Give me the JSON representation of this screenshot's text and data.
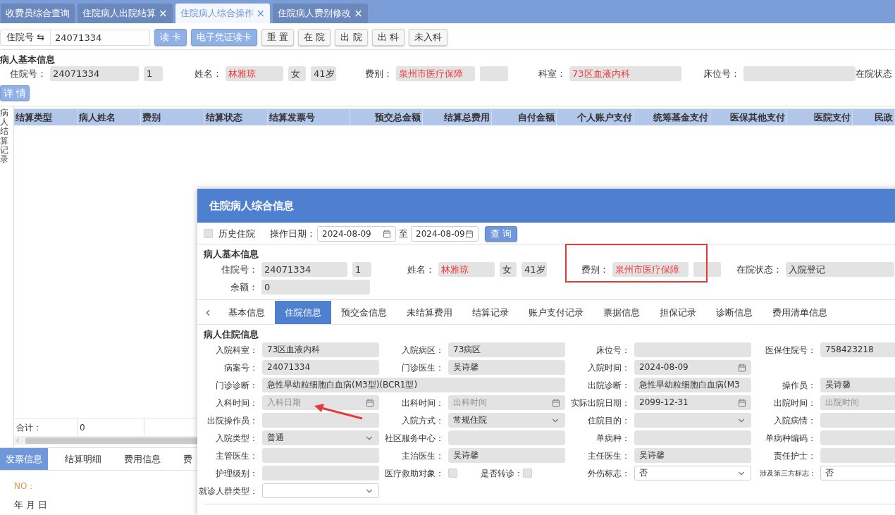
{
  "tabs": [
    {
      "label": "收费员综合查询",
      "selected": false
    },
    {
      "label": "住院病人出院结算",
      "close": "×",
      "selected": false
    },
    {
      "label": "住院病人综合操作",
      "close": "×",
      "selected": true
    },
    {
      "label": "住院病人费别修改",
      "close": "×",
      "selected": false
    }
  ],
  "toolbar": {
    "label": "住院号 ⇆",
    "value": "24071334",
    "buttons": [
      {
        "label": "读 卡",
        "primary": true
      },
      {
        "label": "电子凭证读卡",
        "primary": true
      },
      {
        "label": "重 置",
        "primary": false
      },
      {
        "label": "在 院",
        "primary": false
      },
      {
        "label": "出 院",
        "primary": false
      },
      {
        "label": "出 科",
        "primary": false
      },
      {
        "label": "未入科",
        "primary": false
      }
    ]
  },
  "patient_info": {
    "title": "病人基本信息",
    "groups": [
      {
        "label": "住院号：",
        "boxes": [
          {
            "kind": "text",
            "value": "24071334",
            "highlighted": false
          },
          {
            "kind": "text",
            "value": "1",
            "highlighted": false
          }
        ]
      },
      {
        "label": "姓名：",
        "boxes": [
          {
            "kind": "text",
            "value": "林雅琼",
            "highlighted": true
          },
          {
            "kind": "text",
            "value": "女",
            "highlighted": false
          },
          {
            "kind": "text",
            "value": "41岁",
            "highlighted": false
          }
        ]
      },
      {
        "label": "费别：",
        "boxes": [
          {
            "kind": "text",
            "value": "泉州市医疗保障",
            "highlighted": true
          },
          {
            "kind": "blank"
          }
        ]
      },
      {
        "label": "科室：",
        "boxes": [
          {
            "kind": "text",
            "value": "73区血液内科",
            "highlighted": true
          }
        ]
      },
      {
        "label": "床位号：",
        "boxes": [
          {
            "kind": "blank"
          }
        ]
      },
      {
        "label": "在院状态"
      }
    ]
  },
  "detail_button": "详 情",
  "records": {
    "side_label": "病人结算记录",
    "columns": [
      {
        "label": "结算类型",
        "kind": "text"
      },
      {
        "label": "病人姓名",
        "kind": "text"
      },
      {
        "label": "费别",
        "kind": "text"
      },
      {
        "label": "结算状态",
        "kind": "text"
      },
      {
        "label": "结算发票号",
        "kind": "text"
      },
      {
        "label": "预交总金额",
        "kind": "amount"
      },
      {
        "label": "结算总费用",
        "kind": "amount"
      },
      {
        "label": "自付金额",
        "kind": "amount"
      },
      {
        "label": "个人账户支付",
        "kind": "amount"
      },
      {
        "label": "统筹基金支付",
        "kind": "amount"
      },
      {
        "label": "医保其他支付",
        "kind": "amount"
      },
      {
        "label": "医院支付",
        "kind": "amount"
      },
      {
        "label": "民政",
        "kind": "amount"
      }
    ],
    "total_label": "合计：",
    "total_value": "0"
  },
  "bottom_tabs": [
    {
      "label": "发票信息",
      "selected": true
    },
    {
      "label": "结算明细",
      "selected": false
    },
    {
      "label": "费用信息",
      "selected": false
    },
    {
      "label": "费",
      "selected": false
    }
  ],
  "invoice": {
    "no_label": "NO：",
    "date_line": "年 月 日"
  },
  "dialog": {
    "title": "住院病人综合信息",
    "history": {
      "label": "历史住院",
      "checked": false
    },
    "date_label": "操作日期：",
    "date_from": "2024-08-09",
    "range_sep": "至",
    "date_to": "2024-08-09",
    "query_button": "查 询",
    "basic": {
      "title": "病人基本信息",
      "rows": [
        [
          {
            "label": "住院号：",
            "boxes": [
              {
                "kind": "text",
                "value": "24071334",
                "highlighted": false
              },
              {
                "kind": "text",
                "value": "1",
                "highlighted": false
              }
            ]
          },
          {
            "label": "姓名：",
            "boxes": [
              {
                "kind": "text",
                "value": "林雅琼",
                "highlighted": true
              },
              {
                "kind": "text",
                "value": "女",
                "highlighted": false
              },
              {
                "kind": "text",
                "value": "41岁",
                "highlighted": false
              }
            ]
          },
          {
            "label": "费别：",
            "boxes": [
              {
                "kind": "text",
                "value": "泉州市医疗保障",
                "highlighted": true
              },
              {
                "kind": "blank"
              }
            ]
          },
          {
            "label": "在院状态：",
            "boxes": [
              {
                "kind": "text",
                "value": "入院登记",
                "highlighted": false
              }
            ]
          }
        ],
        [
          {
            "label": "余额：",
            "boxes": [
              {
                "kind": "text",
                "value": "0",
                "highlighted": false
              }
            ]
          }
        ]
      ]
    },
    "tabs": [
      {
        "label": "基本信息",
        "selected": false
      },
      {
        "label": "住院信息",
        "selected": true
      },
      {
        "label": "预交金信息",
        "selected": false
      },
      {
        "label": "未结算费用",
        "selected": false
      },
      {
        "label": "结算记录",
        "selected": false
      },
      {
        "label": "账户支付记录",
        "selected": false
      },
      {
        "label": "票据信息",
        "selected": false
      },
      {
        "label": "担保记录",
        "selected": false
      },
      {
        "label": "诊断信息",
        "selected": false
      },
      {
        "label": "费用清单信息",
        "selected": false
      }
    ],
    "stay": {
      "title": "病人住院信息",
      "rows": [
        [
          {
            "label": "入院科室：",
            "kind": "text",
            "value": "73区血液内科",
            "disabled": true
          },
          {
            "label": "入院病区：",
            "kind": "text",
            "value": "73病区",
            "disabled": true
          },
          {
            "label": "床位号：",
            "kind": "text",
            "disabled": true
          },
          {
            "label": "医保住院号：",
            "kind": "text",
            "value": "758423218",
            "disabled": true
          }
        ],
        [
          {
            "label": "病案号：",
            "kind": "text",
            "value": "24071334",
            "disabled": true
          },
          {
            "label": "门诊医生：",
            "kind": "text",
            "value": "吴诗馨",
            "disabled": true
          },
          {
            "label": "入院时间：",
            "kind": "date",
            "value": "2024-08-09",
            "disabled": true
          }
        ],
        [
          {
            "label": "门诊诊断：",
            "kind": "text",
            "colspan": 2,
            "value": "急性早幼粒细胞白血病(M3型)(BCR1型)",
            "disabled": true
          },
          {
            "label": "出院诊断：",
            "kind": "text",
            "value": "急性早幼粒细胞白血病(M3",
            "disabled": true
          },
          {
            "label": "操作员：",
            "kind": "text",
            "value": "吴诗馨",
            "disabled": true
          }
        ],
        [
          {
            "label": "入科时间：",
            "kind": "date",
            "placeholder": "入科日期",
            "disabled": true
          },
          {
            "label": "出科时间：",
            "kind": "date",
            "placeholder": "出科时间",
            "disabled": true
          },
          {
            "label": "实际出院日期：",
            "kind": "date",
            "value": "2099-12-31",
            "disabled": true
          },
          {
            "label": "出院时间：",
            "kind": "text",
            "placeholder": "出院时间",
            "disabled": true
          }
        ],
        [
          {
            "label": "出院操作员：",
            "kind": "text",
            "disabled": true
          },
          {
            "label": "入院方式：",
            "kind": "select",
            "value": "常规住院",
            "disabled": true
          },
          {
            "label": "住院目的：",
            "kind": "select",
            "disabled": true
          },
          {
            "label": "入院病情：",
            "kind": "text",
            "disabled": true
          }
        ],
        [
          {
            "label": "入院类型：",
            "kind": "select",
            "value": "普通",
            "disabled": true
          },
          {
            "label": "社区服务中心：",
            "kind": "text",
            "disabled": true
          },
          {
            "label": "单病种：",
            "kind": "text",
            "disabled": true
          },
          {
            "label": "单病种编码：",
            "kind": "text",
            "disabled": true
          }
        ],
        [
          {
            "label": "主管医生：",
            "kind": "text",
            "disabled": true
          },
          {
            "label": "主治医生：",
            "kind": "text",
            "value": "吴诗馨",
            "disabled": true
          },
          {
            "label": "主任医生：",
            "kind": "text",
            "value": "吴诗馨",
            "disabled": true
          },
          {
            "label": "责任护士：",
            "kind": "text",
            "disabled": true
          }
        ],
        [
          {
            "label": "护理级别：",
            "kind": "text",
            "disabled": true
          },
          {
            "label": "医疗救助对象：",
            "kind": "checks",
            "checked": false,
            "second": {
              "label": "是否转诊：",
              "checked": false
            }
          },
          {
            "label": "外伤标志：",
            "kind": "select",
            "value": "否",
            "disabled": false
          },
          {
            "label": "涉及第三方标志：",
            "kind": "text",
            "value": "否",
            "disabled": false
          }
        ],
        [
          {
            "label": "就诊人群类型：",
            "kind": "select",
            "disabled": false
          }
        ]
      ]
    }
  }
}
